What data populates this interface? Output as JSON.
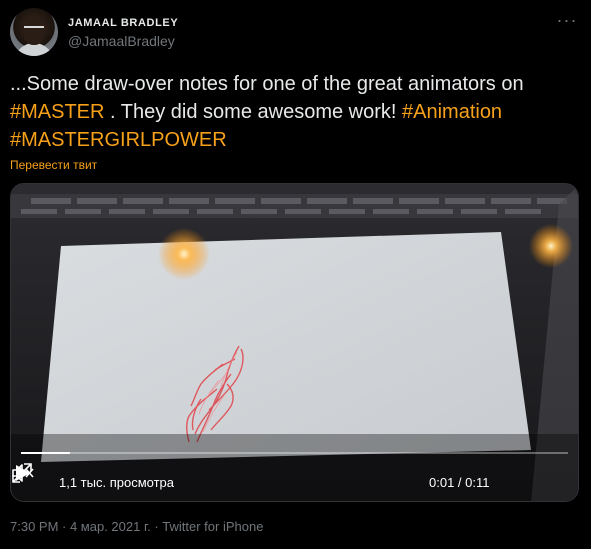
{
  "author": {
    "display_name": "JAMAAL BRADLEY",
    "handle": "@JamaalBradley"
  },
  "tweet": {
    "line1": "...Some draw-over notes for one of the great animators on",
    "tag_master": "#MASTER",
    "line2_mid": " . They did some awesome work!  ",
    "tag_animation": "#Animation",
    "tag_girlpower": "#MASTERGIRLPOWER",
    "translate_label": "Перевести твит"
  },
  "video": {
    "views": "1,1 тыс. просмотра",
    "time": "0:01 / 0:11",
    "progress": 0.09
  },
  "footer": {
    "meta": "7:30 PM · 4 мар. 2021 г. · Twitter for iPhone"
  },
  "colors": {
    "accent": "#f7a11a",
    "background": "#000000",
    "secondary_text": "#71767b"
  },
  "icons": {
    "more": "more-dots-icon",
    "play": "play-icon",
    "mute": "muted-speaker-icon",
    "fullscreen": "fullscreen-icon"
  }
}
